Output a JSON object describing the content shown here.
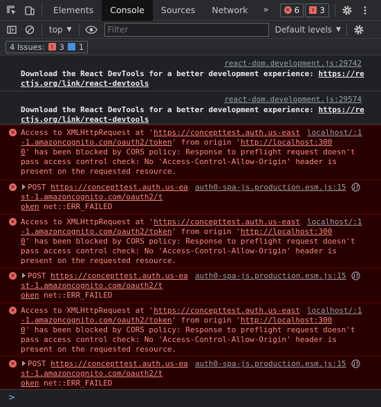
{
  "tabs": {
    "elements": "Elements",
    "console": "Console",
    "sources": "Sources",
    "network": "Network",
    "more": "»"
  },
  "badges": {
    "errors": "6",
    "warnings": "3"
  },
  "toolbar": {
    "context": "top",
    "filter_placeholder": "Filter",
    "levels": "Default levels"
  },
  "issues": {
    "label": "4 Issues:",
    "errors": "3",
    "info": "1"
  },
  "messages": [
    {
      "source": "react-dom.development.js:29742",
      "lines": [
        "Download the React DevTools for a better development experience: ",
        "ctjs.org/link/react-devtools"
      ],
      "link_head": "https://re"
    },
    {
      "source": "react-dom.development.js:29574",
      "lines": [
        "Download the React DevTools for a better development experience: ",
        "ctjs.org/link/react-devtools"
      ],
      "link_head": "https://re"
    }
  ],
  "cors_error": {
    "source1": "localhost/:1",
    "line1_a": "Access to XMLHttpRequest at '",
    "line1_link": "https://concepttest.auth.us-east",
    "line2_link": "-1.amazoncognito.com/oauth2/token",
    "line2_b": "' from origin '",
    "line2_link2": "http://localhost:300",
    "line3_link": "0",
    "line3_b": "' has been blocked by CORS policy: Response to preflight request doesn't",
    "line4": "pass access control check: No 'Access-Control-Allow-Origin' header is",
    "line5": "present on the requested resource."
  },
  "post_error": {
    "source": "auth0-spa-js.production.esm.js:15",
    "method": "POST ",
    "link1": "https://concepttest.auth.us-ea",
    "link2": "st-1.amazoncognito.com/oauth2/t",
    "link3": "oken",
    "status": " net::ERR_FAILED"
  },
  "prompt": ">"
}
